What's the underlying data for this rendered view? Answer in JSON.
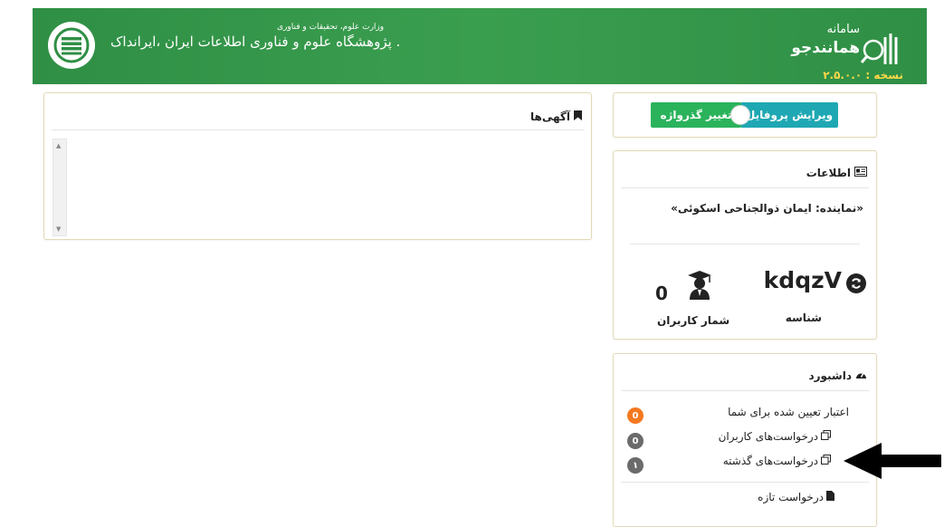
{
  "header": {
    "brand_small": "سامانه",
    "brand_name": "همانندجو",
    "version": "نسخه : ۲.۵.۰.۰",
    "institute_name": "پژوهشگاه علوم و فناوری اطلاعات ایران  ،ایرانداک .",
    "ministry_line": "وزارت علوم، تحقیقات و فناوری"
  },
  "profile_buttons": {
    "edit_profile": "ویرایش پروفایل",
    "change_password": "تغییر گذرواژه"
  },
  "ads_panel": {
    "title": "آگهی‌ها"
  },
  "info_panel": {
    "title": "اطلاعات",
    "representative": "«نماینده: ایمان ذوالجناحی اسکوئی»",
    "identifier_value": "kdqzV",
    "identifier_label": "شناسه",
    "user_count_value": "0",
    "user_count_label": "شمار کاربران"
  },
  "dashboard": {
    "title": "داشبورد",
    "items": [
      {
        "label": "اعتبار تعیین شده برای شما",
        "badge": "0",
        "badge_color": "#f47920"
      },
      {
        "label": "درخواست‌های کاربران",
        "badge": "0",
        "badge_color": "#6b6b6b"
      },
      {
        "label": "درخواست‌های گذشته",
        "badge": "۱",
        "badge_color": "#6b6b6b"
      }
    ],
    "new_request": "درخواست تازه"
  },
  "colors": {
    "header_green": "#3a9e4f",
    "teal": "#1fa8b3",
    "green_button": "#2bb35c",
    "orange_badge": "#f47920"
  }
}
